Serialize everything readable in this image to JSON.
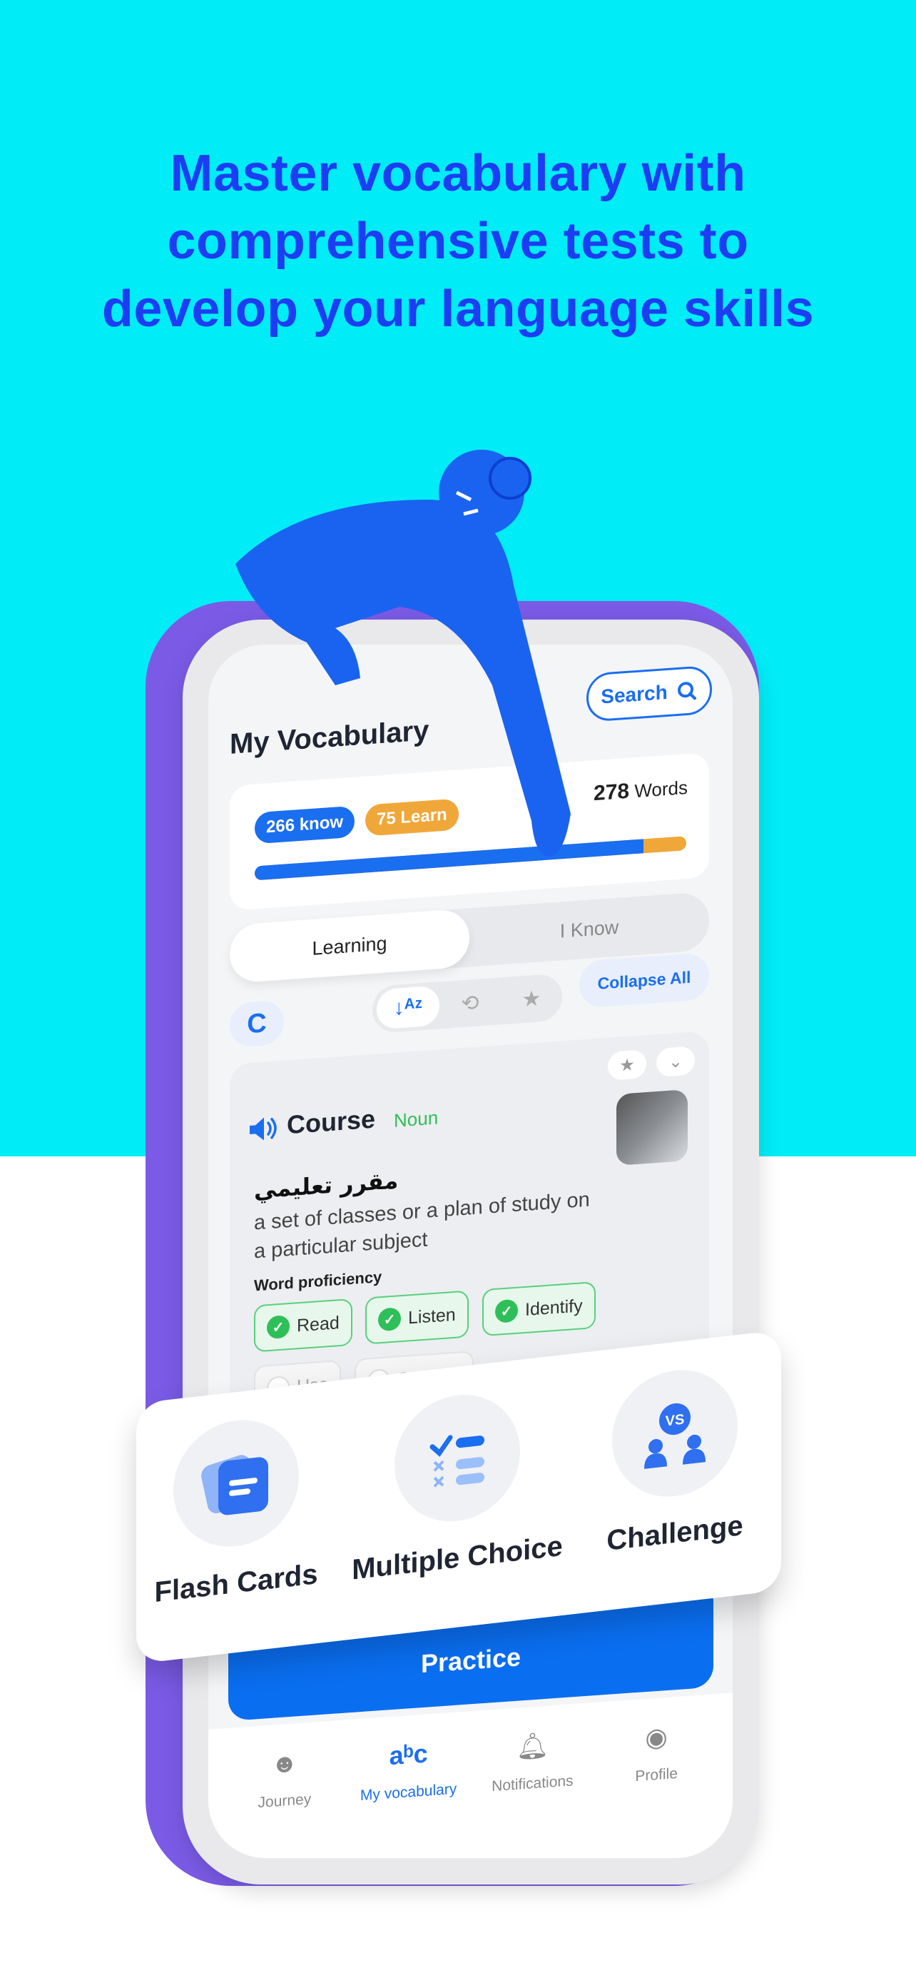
{
  "headline": {
    "line1": "Master vocabulary with",
    "line2": "comprehensive tests to",
    "line3": "develop your language skills"
  },
  "colors": {
    "background_top": "#00ecf7",
    "headline": "#1c3df2",
    "accent": "#1a6ef0",
    "learn": "#f0a73a",
    "phone": "#7b5be6",
    "success": "#2fbf59"
  },
  "header": {
    "title": "My Vocabulary",
    "search_label": "Search",
    "search_icon": "search-icon"
  },
  "stats": {
    "know_label": "266 know",
    "learn_label": "75 Learn",
    "total_number": "278",
    "total_unit": "Words",
    "known_fraction": 0.9
  },
  "tabs": [
    {
      "label": "Learning",
      "active": true
    },
    {
      "label": "I Know",
      "active": false
    }
  ],
  "filters": {
    "letter": "C",
    "sort_icon": "sort-az-icon",
    "recent_icon": "history-add-icon",
    "star_icon": "star-icon",
    "collapse_label": "Collapse All"
  },
  "word_card": {
    "word": "Course",
    "part_of_speech": "Noun",
    "arabic": "مقرر تعليمي",
    "definition": "a set of classes or a plan of study on a particular subject",
    "proficiency_label": "Word proficiency",
    "proficiency": [
      {
        "label": "Read",
        "done": true
      },
      {
        "label": "Listen",
        "done": true
      },
      {
        "label": "Identify",
        "done": true
      },
      {
        "label": "Use",
        "done": false
      },
      {
        "label": "Spelling",
        "done": false
      }
    ]
  },
  "practice_modes": [
    {
      "label": "Flash Cards",
      "icon": "flash-cards-icon"
    },
    {
      "label": "Multiple Choice",
      "icon": "multiple-choice-icon"
    },
    {
      "label": "Challenge",
      "icon": "versus-challenge-icon"
    }
  ],
  "practice_label": "Practice",
  "nav": [
    {
      "label": "Journey",
      "icon": "journey-icon",
      "active": false
    },
    {
      "label": "My vocabulary",
      "icon": "abc-icon",
      "active": true
    },
    {
      "label": "Notifications",
      "icon": "bell-icon",
      "active": false
    },
    {
      "label": "Profile",
      "icon": "profile-icon",
      "active": false
    }
  ]
}
